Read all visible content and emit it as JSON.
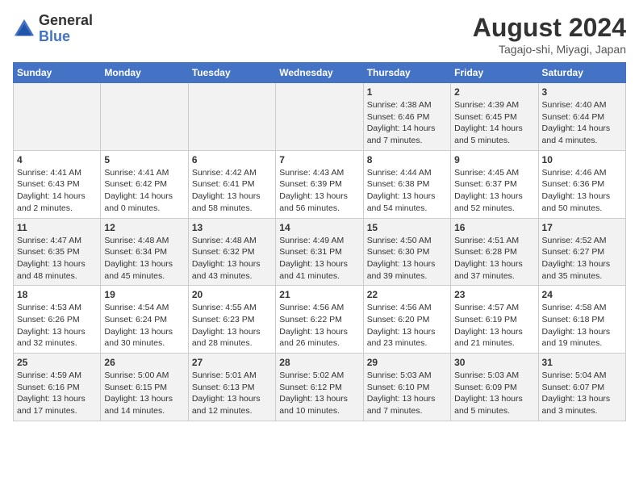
{
  "header": {
    "logo_general": "General",
    "logo_blue": "Blue",
    "month_year": "August 2024",
    "location": "Tagajo-shi, Miyagi, Japan"
  },
  "days_of_week": [
    "Sunday",
    "Monday",
    "Tuesday",
    "Wednesday",
    "Thursday",
    "Friday",
    "Saturday"
  ],
  "weeks": [
    [
      {
        "day": "",
        "info": ""
      },
      {
        "day": "",
        "info": ""
      },
      {
        "day": "",
        "info": ""
      },
      {
        "day": "",
        "info": ""
      },
      {
        "day": "1",
        "info": "Sunrise: 4:38 AM\nSunset: 6:46 PM\nDaylight: 14 hours\nand 7 minutes."
      },
      {
        "day": "2",
        "info": "Sunrise: 4:39 AM\nSunset: 6:45 PM\nDaylight: 14 hours\nand 5 minutes."
      },
      {
        "day": "3",
        "info": "Sunrise: 4:40 AM\nSunset: 6:44 PM\nDaylight: 14 hours\nand 4 minutes."
      }
    ],
    [
      {
        "day": "4",
        "info": "Sunrise: 4:41 AM\nSunset: 6:43 PM\nDaylight: 14 hours\nand 2 minutes."
      },
      {
        "day": "5",
        "info": "Sunrise: 4:41 AM\nSunset: 6:42 PM\nDaylight: 14 hours\nand 0 minutes."
      },
      {
        "day": "6",
        "info": "Sunrise: 4:42 AM\nSunset: 6:41 PM\nDaylight: 13 hours\nand 58 minutes."
      },
      {
        "day": "7",
        "info": "Sunrise: 4:43 AM\nSunset: 6:39 PM\nDaylight: 13 hours\nand 56 minutes."
      },
      {
        "day": "8",
        "info": "Sunrise: 4:44 AM\nSunset: 6:38 PM\nDaylight: 13 hours\nand 54 minutes."
      },
      {
        "day": "9",
        "info": "Sunrise: 4:45 AM\nSunset: 6:37 PM\nDaylight: 13 hours\nand 52 minutes."
      },
      {
        "day": "10",
        "info": "Sunrise: 4:46 AM\nSunset: 6:36 PM\nDaylight: 13 hours\nand 50 minutes."
      }
    ],
    [
      {
        "day": "11",
        "info": "Sunrise: 4:47 AM\nSunset: 6:35 PM\nDaylight: 13 hours\nand 48 minutes."
      },
      {
        "day": "12",
        "info": "Sunrise: 4:48 AM\nSunset: 6:34 PM\nDaylight: 13 hours\nand 45 minutes."
      },
      {
        "day": "13",
        "info": "Sunrise: 4:48 AM\nSunset: 6:32 PM\nDaylight: 13 hours\nand 43 minutes."
      },
      {
        "day": "14",
        "info": "Sunrise: 4:49 AM\nSunset: 6:31 PM\nDaylight: 13 hours\nand 41 minutes."
      },
      {
        "day": "15",
        "info": "Sunrise: 4:50 AM\nSunset: 6:30 PM\nDaylight: 13 hours\nand 39 minutes."
      },
      {
        "day": "16",
        "info": "Sunrise: 4:51 AM\nSunset: 6:28 PM\nDaylight: 13 hours\nand 37 minutes."
      },
      {
        "day": "17",
        "info": "Sunrise: 4:52 AM\nSunset: 6:27 PM\nDaylight: 13 hours\nand 35 minutes."
      }
    ],
    [
      {
        "day": "18",
        "info": "Sunrise: 4:53 AM\nSunset: 6:26 PM\nDaylight: 13 hours\nand 32 minutes."
      },
      {
        "day": "19",
        "info": "Sunrise: 4:54 AM\nSunset: 6:24 PM\nDaylight: 13 hours\nand 30 minutes."
      },
      {
        "day": "20",
        "info": "Sunrise: 4:55 AM\nSunset: 6:23 PM\nDaylight: 13 hours\nand 28 minutes."
      },
      {
        "day": "21",
        "info": "Sunrise: 4:56 AM\nSunset: 6:22 PM\nDaylight: 13 hours\nand 26 minutes."
      },
      {
        "day": "22",
        "info": "Sunrise: 4:56 AM\nSunset: 6:20 PM\nDaylight: 13 hours\nand 23 minutes."
      },
      {
        "day": "23",
        "info": "Sunrise: 4:57 AM\nSunset: 6:19 PM\nDaylight: 13 hours\nand 21 minutes."
      },
      {
        "day": "24",
        "info": "Sunrise: 4:58 AM\nSunset: 6:18 PM\nDaylight: 13 hours\nand 19 minutes."
      }
    ],
    [
      {
        "day": "25",
        "info": "Sunrise: 4:59 AM\nSunset: 6:16 PM\nDaylight: 13 hours\nand 17 minutes."
      },
      {
        "day": "26",
        "info": "Sunrise: 5:00 AM\nSunset: 6:15 PM\nDaylight: 13 hours\nand 14 minutes."
      },
      {
        "day": "27",
        "info": "Sunrise: 5:01 AM\nSunset: 6:13 PM\nDaylight: 13 hours\nand 12 minutes."
      },
      {
        "day": "28",
        "info": "Sunrise: 5:02 AM\nSunset: 6:12 PM\nDaylight: 13 hours\nand 10 minutes."
      },
      {
        "day": "29",
        "info": "Sunrise: 5:03 AM\nSunset: 6:10 PM\nDaylight: 13 hours\nand 7 minutes."
      },
      {
        "day": "30",
        "info": "Sunrise: 5:03 AM\nSunset: 6:09 PM\nDaylight: 13 hours\nand 5 minutes."
      },
      {
        "day": "31",
        "info": "Sunrise: 5:04 AM\nSunset: 6:07 PM\nDaylight: 13 hours\nand 3 minutes."
      }
    ]
  ]
}
